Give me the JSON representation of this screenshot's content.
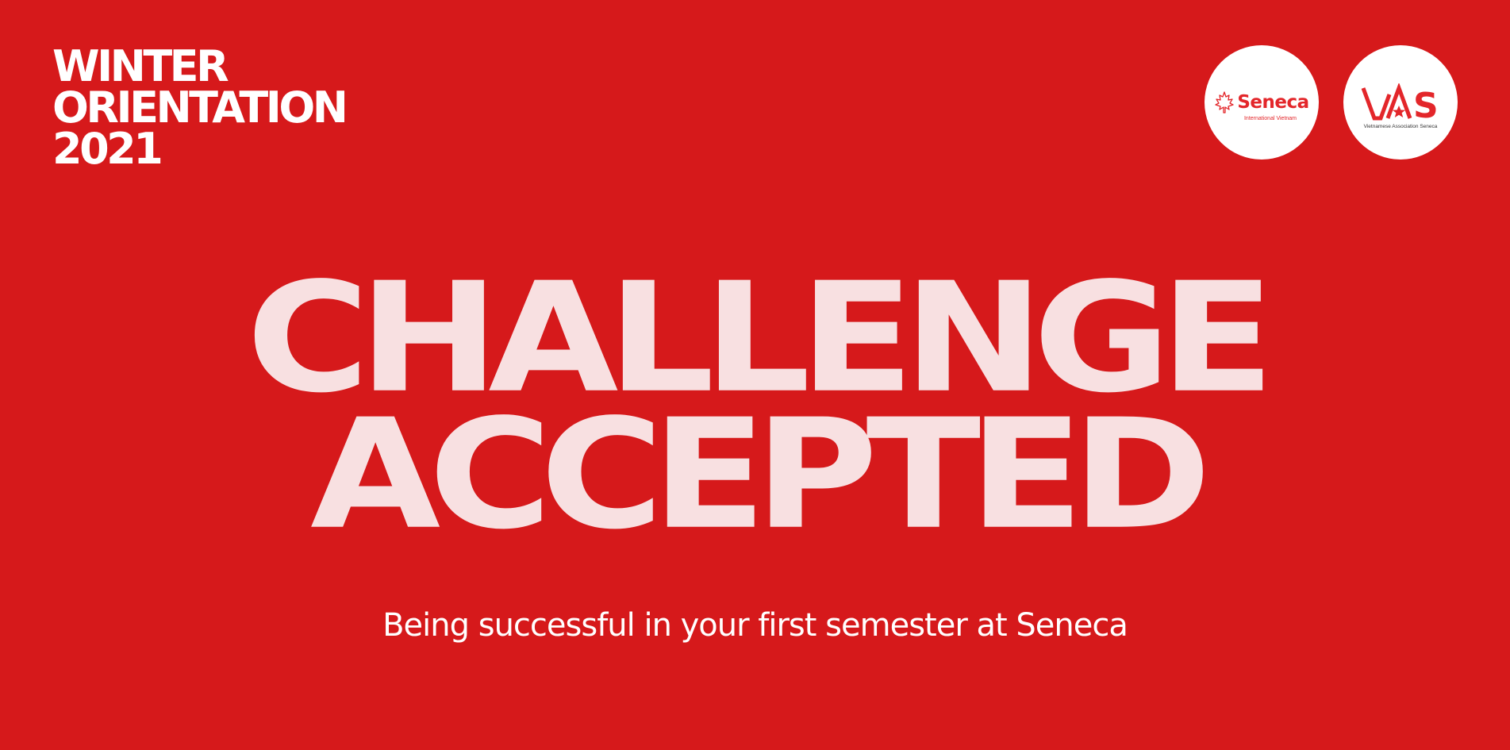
{
  "colors": {
    "background": "#d6191b",
    "headline": "#f8e0e1",
    "logo_red": "#e3262a",
    "white": "#ffffff"
  },
  "event_title": {
    "line1": "WINTER",
    "line2": "ORIENTATION",
    "line3": "2021"
  },
  "logos": [
    {
      "name": "Seneca",
      "sub": "International Vietnam",
      "icon": "maple-leaf-icon"
    },
    {
      "name": "VAS",
      "sub": "Vietnamese Association Seneca",
      "icon": "vas-logo-icon"
    }
  ],
  "headline": {
    "line1": "CHALLENGE",
    "line2": "ACCEPTED"
  },
  "tagline": "Being successful in your first semester at Seneca"
}
